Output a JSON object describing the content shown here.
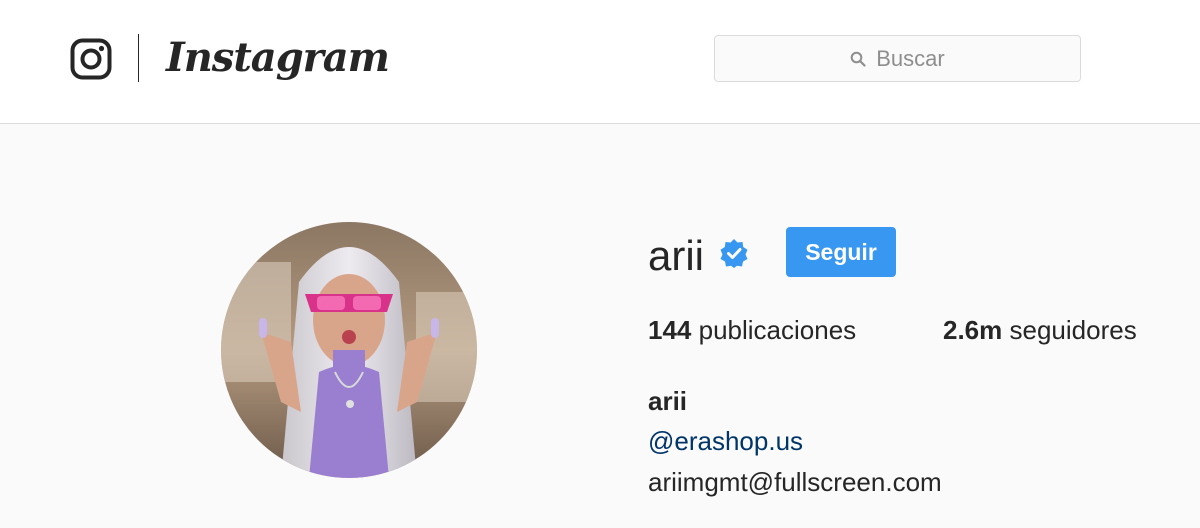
{
  "header": {
    "logo_text": "Instagram",
    "search_placeholder": "Buscar"
  },
  "profile": {
    "username": "arii",
    "verified": true,
    "follow_label": "Seguir",
    "stats": [
      {
        "value": "144",
        "label": "publicaciones"
      },
      {
        "value": "2.6m",
        "label": "seguidores"
      }
    ],
    "bio": {
      "name": "arii",
      "link": "@erashop.us",
      "email": "ariimgmt@fullscreen.com"
    }
  },
  "colors": {
    "accent": "#3897f0",
    "link": "#003569",
    "background": "#fafafa",
    "border": "#dbdbdb"
  }
}
